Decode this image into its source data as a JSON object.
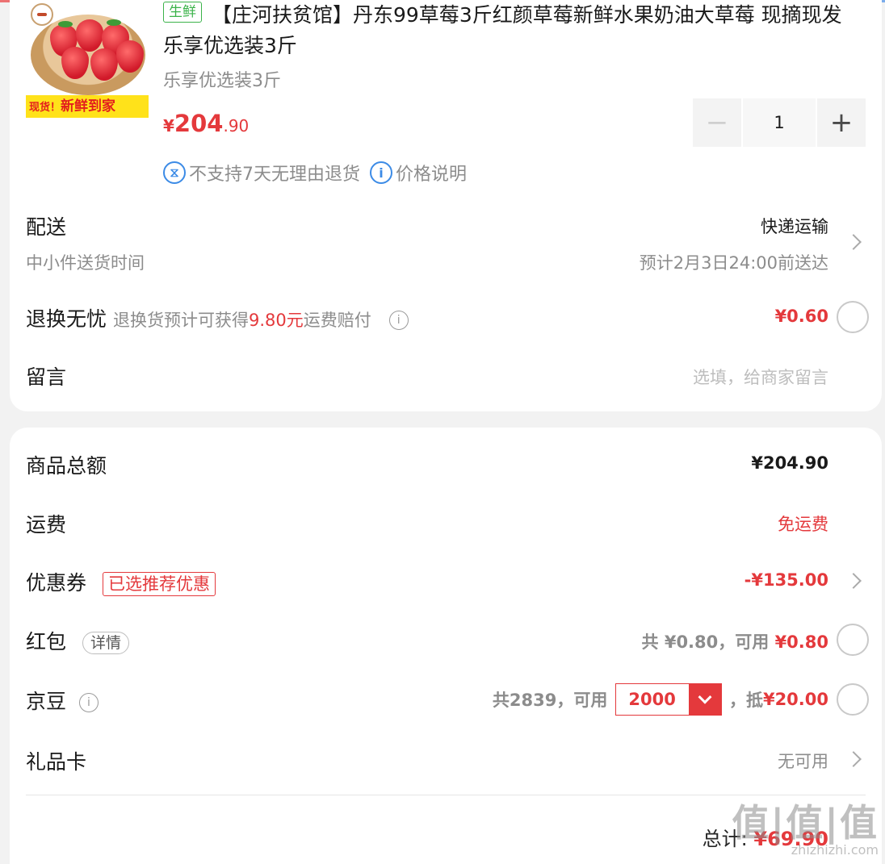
{
  "product": {
    "tag": "生鲜",
    "title": "【庄河扶贫馆】丹东99草莓3斤红颜草莓新鲜水果奶油大草莓 现摘现发 乐享优选装3斤",
    "spec": "乐享优选装3斤",
    "price_symbol": "¥",
    "price_int": "204",
    "price_dec": ".90",
    "thumb_banner_small": "现货！",
    "thumb_banner_big": "新鲜到家",
    "quantity": "1",
    "minus": "−",
    "plus": "+",
    "notice_return": "不支持7天无理由退货",
    "notice_price": "价格说明"
  },
  "delivery": {
    "label": "配送",
    "method": "快递运输",
    "sub_label": "中小件送货时间",
    "eta": "预计2月3日24:00前送达"
  },
  "return_insurance": {
    "label": "退换无忧",
    "desc_prefix": "退换货预计可获得",
    "desc_amount": "9.80元",
    "desc_suffix": "运费赔付",
    "price": "¥0.60"
  },
  "message": {
    "label": "留言",
    "placeholder": "选填，给商家留言"
  },
  "summary": {
    "goods_label": "商品总额",
    "goods_value": "¥204.90",
    "shipping_label": "运费",
    "shipping_value": "免运费",
    "coupon_label": "优惠券",
    "coupon_tag": "已选推荐优惠",
    "coupon_value": "-¥135.00",
    "redpacket_label": "红包",
    "redpacket_tag": "详情",
    "redpacket_total": "共 ¥0.80，可用 ",
    "redpacket_available": "¥0.80",
    "jingdou_label": "京豆",
    "jingdou_total": "共2839，可用",
    "jingdou_select": "2000",
    "jingdou_deduct_prefix": "，抵",
    "jingdou_deduct": "¥20.00",
    "giftcard_label": "礼品卡",
    "giftcard_value": "无可用",
    "total_label": "总计:",
    "total_value": "¥69.90"
  },
  "watermark": {
    "brand": "值|值|值",
    "url": "zhizhizhi.com"
  },
  "colors": {
    "accent_red": "#e4393c",
    "fresh_green": "#3bb34a",
    "info_blue": "#3c8be6"
  }
}
